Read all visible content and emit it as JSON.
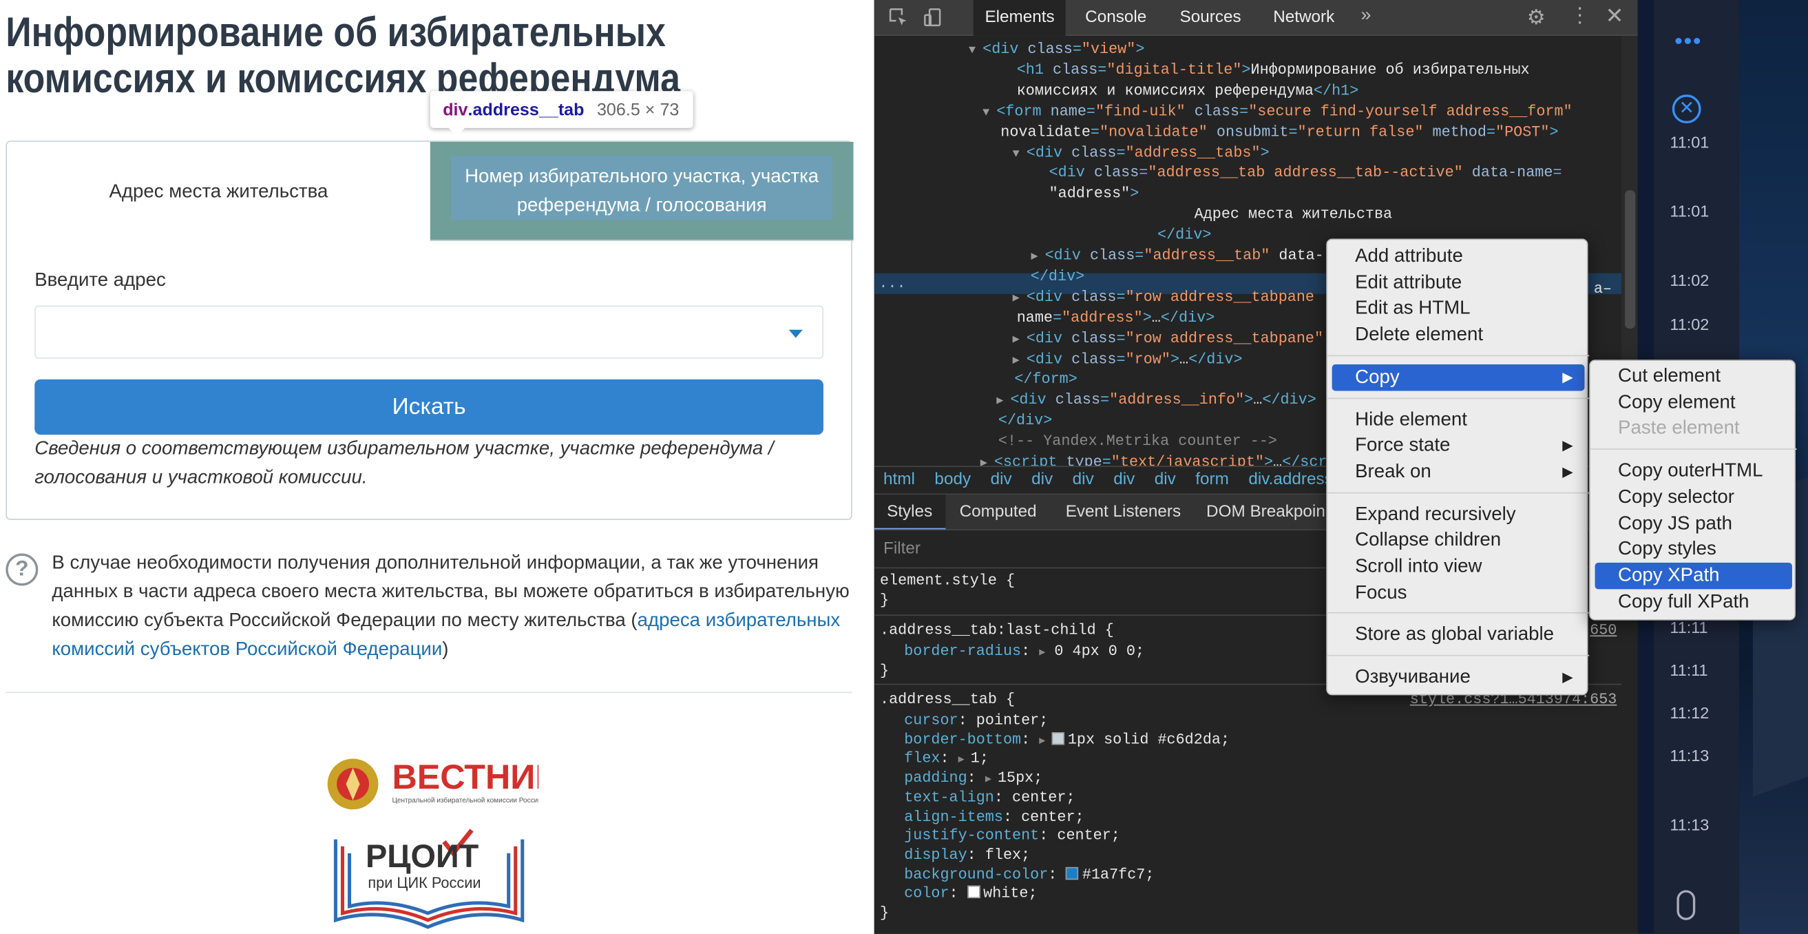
{
  "page": {
    "title": "Информирование об избирательных комиссиях и комиссиях референдума",
    "tabs": {
      "active": "Адрес места жительства",
      "other": "Номер избирательного участка, участка референдума / голосования"
    },
    "address_label": "Введите адрес",
    "search_button": "Искать",
    "hint": "Сведения о соответствующем избирательном участке, участке референдума / голосования и участковой комиссии.",
    "info_icon": "?",
    "info_text": "В случае необходимости получения дополнительной информации, а так же уточнения данных в части адреса своего места жительства, вы можете обратиться в избирательную комиссию субъекта Российской Федерации по месту жительства (",
    "info_link": "адреса избирательных комиссий субъектов Российской Федерации",
    "info_text_end": ")",
    "logo1_text": "ВЕСТНИК",
    "logo1_sub": "Центральной избирательной комиссии Российской Федерации",
    "logo2_text": "РЦОИТ",
    "logo2_sub": "при ЦИК России",
    "tooltip": {
      "tag": "div",
      "cls": ".address__tab",
      "dims": "306.5 × 73"
    }
  },
  "devtools": {
    "tabs": [
      "Elements",
      "Console",
      "Sources",
      "Network"
    ],
    "more": "»",
    "dom_lines": [
      {
        "indent": 92,
        "arrow": "▼",
        "html": "<div class=\"view\">"
      },
      {
        "indent": 118,
        "arrow": "",
        "html": "<h1 class=\"digital-title\">Информирование об избирательных"
      },
      {
        "indent": 118,
        "arrow": "",
        "html": "комиссиях и комиссиях референдума</h1>"
      },
      {
        "indent": 104,
        "arrow": "▼",
        "html": "<form name=\"find-uik\" class=\"secure find-yourself address__form\""
      },
      {
        "indent": 104,
        "arrow": "",
        "html": "novalidate=\"novalidate\" onsubmit=\"return false\" method=\"POST\">"
      },
      {
        "indent": 130,
        "arrow": "▼",
        "html": "<div class=\"address__tabs\">"
      },
      {
        "indent": 146,
        "arrow": "",
        "html": "<div class=\"address__tab address__tab--active\" data-name="
      },
      {
        "indent": 146,
        "arrow": "",
        "html": "\"address\">"
      },
      {
        "indent": 272,
        "arrow": "",
        "html": "Адрес места жительства"
      },
      {
        "indent": 240,
        "arrow": "",
        "html": "</div>"
      },
      {
        "indent": 146,
        "arrow": "▶",
        "html": "<div class=\"address__tab\" data-"
      },
      {
        "indent": 130,
        "arrow": "",
        "html": "</div>"
      },
      {
        "indent": 130,
        "arrow": "▶",
        "html": "<div class=\"row address__tabpane"
      },
      {
        "indent": 118,
        "arrow": "",
        "html": "name=\"address\">…</div>"
      },
      {
        "indent": 130,
        "arrow": "▶",
        "html": "<div class=\"row address__tabpane\""
      },
      {
        "indent": 130,
        "arrow": "▶",
        "html": "<div class=\"row\">…</div>"
      },
      {
        "indent": 116,
        "arrow": "",
        "html": "</form>"
      },
      {
        "indent": 116,
        "arrow": "▶",
        "html": "<div class=\"address__info\">…</div>"
      },
      {
        "indent": 102,
        "arrow": "",
        "html": "</div>"
      },
      {
        "indent": 102,
        "arrow": "",
        "html": "<!-- Yandex.Metrika counter -->"
      },
      {
        "indent": 102,
        "arrow": "▶",
        "html": "<script type=\"text/javascript\">…</scr"
      }
    ],
    "dom_tail_right": "a–",
    "breadcrumbs": [
      "html",
      "body",
      "div",
      "div",
      "div",
      "div",
      "div",
      "form",
      "div.address"
    ],
    "subtabs": [
      "Styles",
      "Computed",
      "Event Listeners",
      "DOM Breakpoin"
    ],
    "filter_placeholder": "Filter",
    "styles": {
      "element_style": "element.style {",
      "close": "}",
      "rule1_selector": ".address__tab:last-child {",
      "rule1_src": "650",
      "rule1_prop": "border-radius",
      "rule1_val": "0 4px 0 0;",
      "rule2_selector": ".address__tab {",
      "rule2_src": "style.css?1…5413974:653",
      "rule2_props": [
        {
          "name": "cursor",
          "val": "pointer;",
          "tri": false,
          "swatch": ""
        },
        {
          "name": "border-bottom",
          "val": "1px solid #c6d2da;",
          "tri": true,
          "swatch": "#c6d2da"
        },
        {
          "name": "flex",
          "val": "1;",
          "tri": true,
          "swatch": ""
        },
        {
          "name": "padding",
          "val": "15px;",
          "tri": true,
          "swatch": ""
        },
        {
          "name": "text-align",
          "val": "center;",
          "tri": false,
          "swatch": ""
        },
        {
          "name": "align-items",
          "val": "center;",
          "tri": false,
          "swatch": ""
        },
        {
          "name": "justify-content",
          "val": "center;",
          "tri": false,
          "swatch": ""
        },
        {
          "name": "display",
          "val": "flex;",
          "tri": false,
          "swatch": ""
        },
        {
          "name": "background-color",
          "val": "#1a7fc7;",
          "tri": false,
          "swatch": "#1a7fc7"
        },
        {
          "name": "color",
          "val": "white;",
          "tri": false,
          "swatch": "#ffffff"
        }
      ]
    }
  },
  "context_menu": {
    "items": [
      {
        "label": "Add attribute",
        "sub": false,
        "hi": false,
        "dis": false
      },
      {
        "label": "Edit attribute",
        "sub": false,
        "hi": false,
        "dis": false
      },
      {
        "label": "Edit as HTML",
        "sub": false,
        "hi": false,
        "dis": false
      },
      {
        "label": "Delete element",
        "sub": false,
        "hi": false,
        "dis": false
      },
      {
        "sep": true
      },
      {
        "label": "Copy",
        "sub": true,
        "hi": true,
        "dis": false
      },
      {
        "sep": true
      },
      {
        "label": "Hide element",
        "sub": false,
        "hi": false,
        "dis": false
      },
      {
        "label": "Force state",
        "sub": true,
        "hi": false,
        "dis": false
      },
      {
        "label": "Break on",
        "sub": true,
        "hi": false,
        "dis": false
      },
      {
        "sep": true
      },
      {
        "label": "Expand recursively",
        "sub": false,
        "hi": false,
        "dis": false
      },
      {
        "label": "Collapse children",
        "sub": false,
        "hi": false,
        "dis": false
      },
      {
        "label": "Scroll into view",
        "sub": false,
        "hi": false,
        "dis": false
      },
      {
        "label": "Focus",
        "sub": false,
        "hi": false,
        "dis": false
      },
      {
        "sep": true
      },
      {
        "label": "Store as global variable",
        "sub": false,
        "hi": false,
        "dis": false
      },
      {
        "sep": true
      },
      {
        "label": "Озвучивание",
        "sub": true,
        "hi": false,
        "dis": false
      }
    ],
    "submenu": [
      {
        "label": "Cut element",
        "hi": false,
        "dis": false
      },
      {
        "label": "Copy element",
        "hi": false,
        "dis": false
      },
      {
        "label": "Paste element",
        "hi": false,
        "dis": true
      },
      {
        "sep": true
      },
      {
        "label": "Copy outerHTML",
        "hi": false,
        "dis": false
      },
      {
        "label": "Copy selector",
        "hi": false,
        "dis": false
      },
      {
        "label": "Copy JS path",
        "hi": false,
        "dis": false
      },
      {
        "label": "Copy styles",
        "hi": false,
        "dis": false
      },
      {
        "label": "Copy XPath",
        "hi": true,
        "dis": false
      },
      {
        "label": "Copy full XPath",
        "hi": false,
        "dis": false
      }
    ],
    "submenu_arrow": "▶"
  },
  "desktop": {
    "more_icon": "•••",
    "close_icon": "✕",
    "times": [
      "11:01",
      "11:01",
      "11:02",
      "11:02",
      "11:11",
      "11:11",
      "11:12",
      "11:13",
      "11:13"
    ]
  },
  "colors": {
    "accent": "#3183cf",
    "link": "#1a6fb0",
    "highlight": "#2a64d0"
  }
}
